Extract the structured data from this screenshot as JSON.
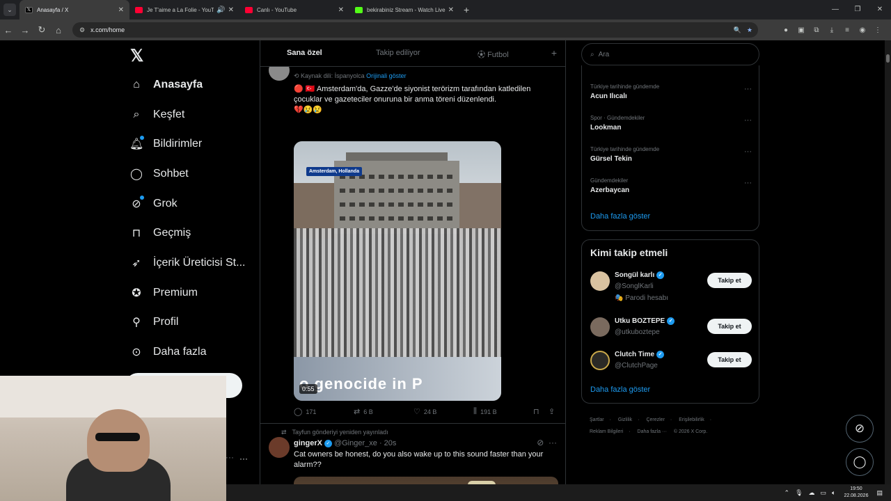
{
  "browser": {
    "tabs": [
      {
        "title": "Anasayfa / X",
        "icon": "x-logo-icon",
        "color": "#000000",
        "active": true
      },
      {
        "title": "Je T'aime a La Folie - YouTu",
        "icon": "youtube-icon",
        "color": "#ff0033",
        "audio": true
      },
      {
        "title": "Canlı - YouTube",
        "icon": "youtube-icon",
        "color": "#ff0033"
      },
      {
        "title": "bekirabiniz Stream - Watch Live",
        "icon": "kick-icon",
        "color": "#53fc18"
      }
    ],
    "url": "x.com/home"
  },
  "sidebar": {
    "items": [
      {
        "label": "Anasayfa",
        "icon": "home-icon",
        "bold": true
      },
      {
        "label": "Keşfet",
        "icon": "search-icon"
      },
      {
        "label": "Bildirimler",
        "icon": "bell-icon",
        "dot": true
      },
      {
        "label": "Sohbet",
        "icon": "chat-icon"
      },
      {
        "label": "Grok",
        "icon": "grok-icon",
        "dot": true
      },
      {
        "label": "Geçmiş",
        "icon": "bookmark-icon"
      },
      {
        "label": "İçerik Üreticisi St...",
        "icon": "rocket-icon"
      },
      {
        "label": "Premium",
        "icon": "verified-icon"
      },
      {
        "label": "Profil",
        "icon": "person-icon"
      },
      {
        "label": "Daha fazla",
        "icon": "more-circle-icon"
      }
    ]
  },
  "feed": {
    "tabs": [
      "Sana özel",
      "Takip ediliyor",
      "Futbol"
    ],
    "tweet1": {
      "source_prefix": "Kaynak dili: İspanyolca",
      "source_link": "Orijinali göster",
      "text_line1": "🔴 🇹🇷 Amsterdam'da, Gazze'de siyonist terörizm tarafından katledilen",
      "text_line2": "çocuklar ve gazeteciler onuruna bir anma töreni düzenlendi.",
      "text_line3": "💔😢😢",
      "location_badge": "Amsterdam, Hollanda",
      "banner_text": "o genocide in P",
      "duration": "0:55",
      "replies": "171",
      "retweets": "6 B",
      "likes": "24 B",
      "views": "191 B"
    },
    "tweet2": {
      "retweeted_by": "Tayfun gönderiyi yeniden yayınladı",
      "name": "gingerX",
      "handle": "@Ginger_xe",
      "time": "· 20s",
      "text_line1": "Cat owners be honest, do you also wake up to this sound faster than your",
      "text_line2": "alarm??"
    }
  },
  "right": {
    "search_placeholder": "Ara",
    "trends": [
      {
        "category": "Türkiye tarihinde gündemde",
        "name": "Acun Ilıcalı"
      },
      {
        "category": "Spor · Gündemdekiler",
        "name": "Lookman"
      },
      {
        "category": "Türkiye tarihinde gündemde",
        "name": "Gürsel Tekin"
      },
      {
        "category": "Gündemdekiler",
        "name": "Azerbaycan"
      }
    ],
    "trends_more": "Daha fazla göster",
    "who_to_follow_title": "Kimi takip etmeli",
    "who_to_follow": [
      {
        "name": "Songül karlı",
        "handle": "@SonglKarli",
        "extra": "🎭 Parodi hesabı",
        "button": "Takip et"
      },
      {
        "name": "Utku BOZTEPE",
        "handle": "@utkuboztepe",
        "button": "Takip et"
      },
      {
        "name": "Clutch Time",
        "handle": "@ClutchPage",
        "button": "Takip et"
      }
    ],
    "wtf_more": "Daha fazla göster",
    "footer": [
      "Şartlar",
      "Gizlilik",
      "Çerezler",
      "Erişilebilirlik",
      "Reklam Bilgileri",
      "Daha fazla ···",
      "© 2026 X Corp."
    ]
  },
  "taskbar": {
    "time": "19:50",
    "date": "22.08.2026"
  }
}
